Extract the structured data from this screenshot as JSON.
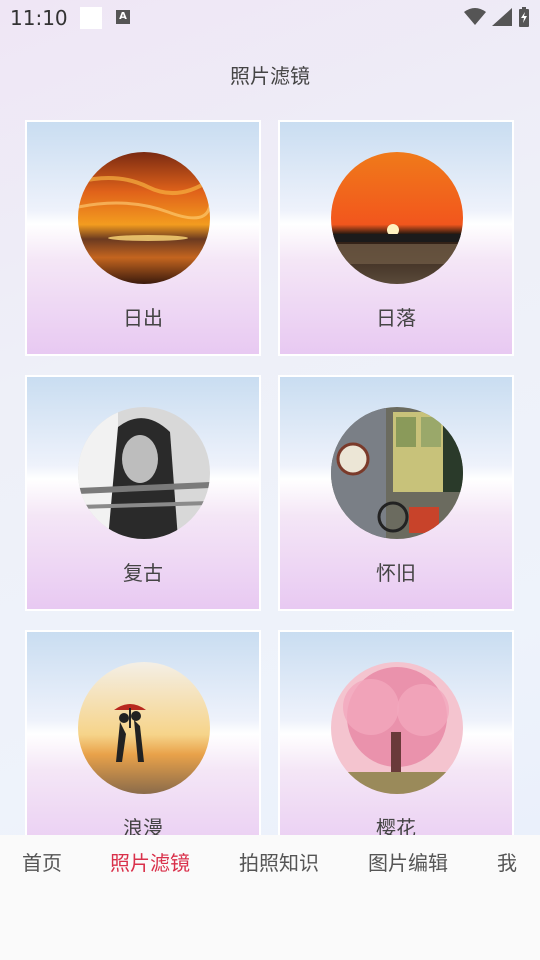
{
  "status_bar": {
    "time": "11:10",
    "notification_icon_letter": "A"
  },
  "page": {
    "title": "照片滤镜"
  },
  "filters": [
    {
      "label": "日出"
    },
    {
      "label": "日落"
    },
    {
      "label": "复古"
    },
    {
      "label": "怀旧"
    },
    {
      "label": "浪漫"
    },
    {
      "label": "樱花"
    }
  ],
  "bottom_nav": {
    "items": [
      {
        "label": "首页"
      },
      {
        "label": "照片滤镜",
        "active": true
      },
      {
        "label": "拍照知识"
      },
      {
        "label": "图片编辑"
      },
      {
        "label": "我"
      }
    ]
  },
  "colors": {
    "active_tab": "#d9304a",
    "text": "#444444"
  }
}
